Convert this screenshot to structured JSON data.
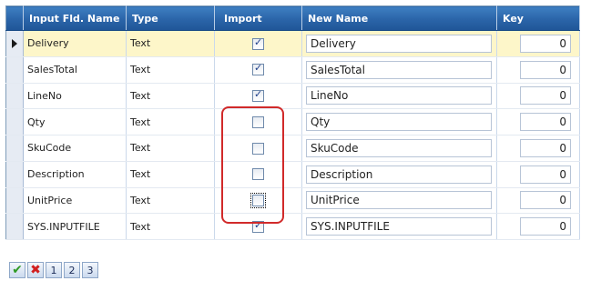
{
  "grid": {
    "columns": {
      "name": "Input Fld. Name",
      "type": "Type",
      "import": "Import",
      "new_name": "New Name",
      "key": "Key"
    },
    "rows": [
      {
        "name": "Delivery",
        "type": "Text",
        "import": true,
        "new_name": "Delivery",
        "key": "0"
      },
      {
        "name": "SalesTotal",
        "type": "Text",
        "import": true,
        "new_name": "SalesTotal",
        "key": "0"
      },
      {
        "name": "LineNo",
        "type": "Text",
        "import": true,
        "new_name": "LineNo",
        "key": "0"
      },
      {
        "name": "Qty",
        "type": "Text",
        "import": false,
        "new_name": "Qty",
        "key": "0"
      },
      {
        "name": "SkuCode",
        "type": "Text",
        "import": false,
        "new_name": "SkuCode",
        "key": "0"
      },
      {
        "name": "Description",
        "type": "Text",
        "import": false,
        "new_name": "Description",
        "key": "0"
      },
      {
        "name": "UnitPrice",
        "type": "Text",
        "import": false,
        "new_name": "UnitPrice",
        "key": "0"
      },
      {
        "name": "SYS.INPUTFILE",
        "type": "Text",
        "import": true,
        "new_name": "SYS.INPUTFILE",
        "key": "0"
      }
    ],
    "current_row": 0,
    "focused_checkbox_row": 6
  },
  "highlight": {
    "color": "#d12a2a"
  },
  "toolbar": {
    "ok_icon": "check-icon",
    "cancel_icon": "cross-icon",
    "ok_glyph": "✔",
    "cancel_glyph": "✖",
    "page_1": "1",
    "page_2": "2",
    "page_3": "3"
  }
}
